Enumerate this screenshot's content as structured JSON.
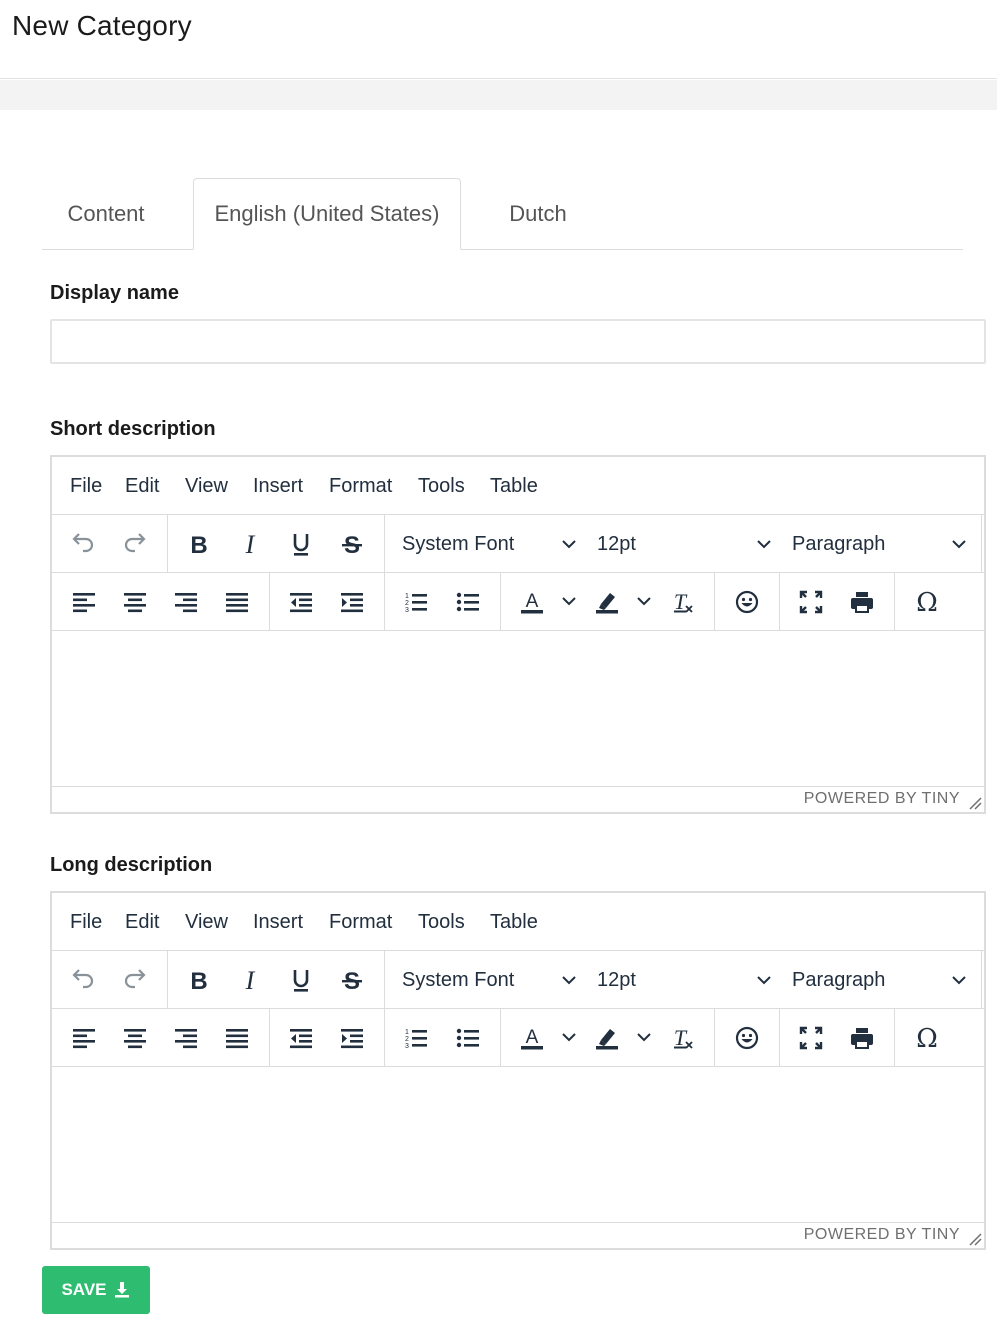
{
  "page": {
    "title": "New Category"
  },
  "tabs": [
    {
      "label": "Content"
    },
    {
      "label": "English (United States)"
    },
    {
      "label": "Dutch"
    }
  ],
  "display_name": {
    "label": "Display name",
    "value": ""
  },
  "editors": [
    {
      "label": "Short description",
      "menu": [
        "File",
        "Edit",
        "View",
        "Insert",
        "Format",
        "Tools",
        "Table"
      ],
      "font_family": "System Font",
      "font_size": "12pt",
      "block_format": "Paragraph",
      "powered_by": "POWERED BY TINY"
    },
    {
      "label": "Long description",
      "menu": [
        "File",
        "Edit",
        "View",
        "Insert",
        "Format",
        "Tools",
        "Table"
      ],
      "font_family": "System Font",
      "font_size": "12pt",
      "block_format": "Paragraph",
      "powered_by": "POWERED BY TINY"
    }
  ],
  "save_button": {
    "label": "SAVE"
  },
  "colors": {
    "accent_green": "#2ebc71",
    "icon": "#222f3e",
    "disabled_icon": "#8a9299",
    "border": "#dcdcdc"
  }
}
